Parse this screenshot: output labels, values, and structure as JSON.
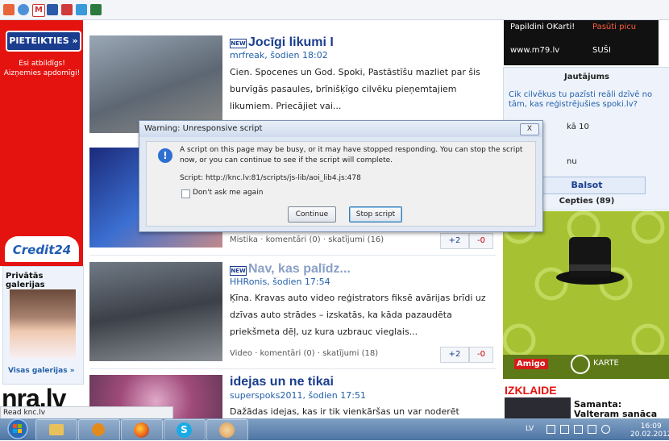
{
  "left": {
    "button": "PIETEIKTIES »",
    "tagline": "Esi atbildīgs! Aizņemies apdomīgi!",
    "brand": "Credit24",
    "gallery_title": "Privātās galerijas",
    "gallery_link": "Visas galerijas »",
    "site_logo": "nra.lv"
  },
  "articles": [
    {
      "title": "Jocīgi likumi I",
      "meta": "mrfreak, šodien 18:02",
      "desc": "Cien. Spocenes un God. Spoki, Pastāstīšu mazliet par šis burvīgās pasaules, brīnišķīgo cilvēku pieņemtajiem likumiem. Priecājiet vai...",
      "footer": "",
      "plus": "",
      "minus": ""
    },
    {
      "title": "",
      "meta": "",
      "desc": "",
      "footer": "Mistika · komentāri (0) · skatījumi (16)",
      "plus": "+2",
      "minus": "-0"
    },
    {
      "title": "Nav, kas palīdz...",
      "meta": "HHRonis, šodien 17:54",
      "desc": "Ķīna. Kravas auto video reģistrators fiksē avārijas brīdi uz dzīvas auto strādes – izskatās, ka kāda pazaudēta priekšmeta dēļ, uz kura uzbrauc vieglais...",
      "footer": "Video · komentāri (0) · skatījumi (18)",
      "plus": "+2",
      "minus": "-0"
    },
    {
      "title": "idejas un ne tikai",
      "meta": "superspoks2011, šodien 17:51",
      "desc": "Dažādas idejas, kas ir tik vienkāršas un var noderēt ikvienam"
    }
  ],
  "new_badge": "NEW",
  "right": {
    "top_links": [
      "Papildini OKarti!",
      "Pasūti picu",
      "www.m79.lv",
      "SUŠI"
    ],
    "poll_title": "Jautājums",
    "poll_question": "Cik cilvēkus tu pazīsti reāli dzīvē no tām, kas reģistrējušies spoki.lv?",
    "poll_option": "kā 10",
    "poll_option2": "nu",
    "poll_button": "Balsot",
    "poll_result": "Cepties (89)",
    "ad_brand": "Amigo",
    "ad_card": "KARTE",
    "section": "IZKLAIDE",
    "teaser": "Samanta: Valteram sanāca"
  },
  "dialog": {
    "title": "Warning: Unresponsive script",
    "close": "X",
    "message": "A script on this page may be busy, or it may have stopped responding. You can stop the script now, or you can continue to see if the script will complete.",
    "script": "Script: http://knc.lv:81/scripts/js-lib/aoi_lib4.js:478",
    "checkbox": "Don't ask me again",
    "continue": "Continue",
    "stop": "Stop script"
  },
  "status_text": "Read knc.lv",
  "taskbar": {
    "lang": "LV",
    "time": "16:09",
    "date": "20.02.2012"
  },
  "colors": {
    "accent": "#1a3d8e",
    "ad_red": "#e5130f",
    "link": "#2360a9",
    "amigo_green": "#a6c232"
  }
}
